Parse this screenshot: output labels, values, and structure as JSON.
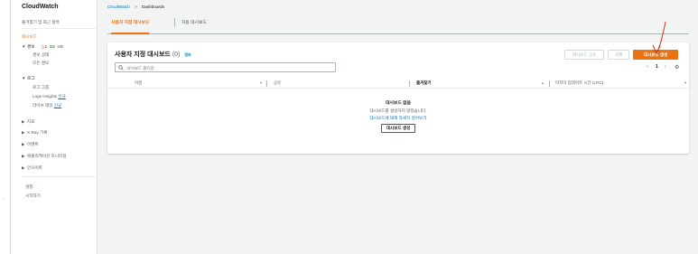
{
  "sidebar": {
    "title": "CloudWatch",
    "favorites": "즐겨찾기 및 최근 항목",
    "dashboards": "대시보드",
    "alarms": {
      "label": "경보",
      "in_alarm": "1",
      "ok": "2",
      "insufficient": "0",
      "state": "경보 상태",
      "all": "모든 경보"
    },
    "logs": {
      "label": "로그",
      "groups": "로그 그룹",
      "insights": "Logs Insights",
      "live_tail": "라이브 테일",
      "new_badge": "신규"
    },
    "metrics": "지표",
    "xray": "X-Ray 기록",
    "events": "이벤트",
    "app_monitoring": "애플리케이션 모니터링",
    "insights": "인사이트",
    "settings": "설정",
    "getting_started": "시작하기"
  },
  "breadcrumb": {
    "root": "CloudWatch",
    "current": "Dashboards"
  },
  "tabs": [
    {
      "label": "사용자 지정 대시보드"
    },
    {
      "label": "자동 대시보드"
    }
  ],
  "panel": {
    "title": "사용자 지정 대시보드",
    "count": "(0)",
    "info": "정보",
    "share_button": "대시보드 공유",
    "delete_button": "삭제",
    "create_button": "대시보드 생성",
    "search_placeholder": "대시보드 필터링",
    "page": "1",
    "columns": {
      "name": "이름",
      "sharing": "공유",
      "favorites": "즐겨찾기",
      "last_updated": "마지막 업데이트 시간 (UTC)"
    },
    "empty": {
      "title": "대시보드 없음",
      "description": "대시보드를 생성하지 않았습니다.",
      "learn_more": "대시보드에 대해 자세히 알아보기",
      "create_button": "대시보드 생성"
    }
  },
  "colors": {
    "accent": "#ec7211",
    "link": "#0073bb",
    "annotation": "#d13212"
  }
}
